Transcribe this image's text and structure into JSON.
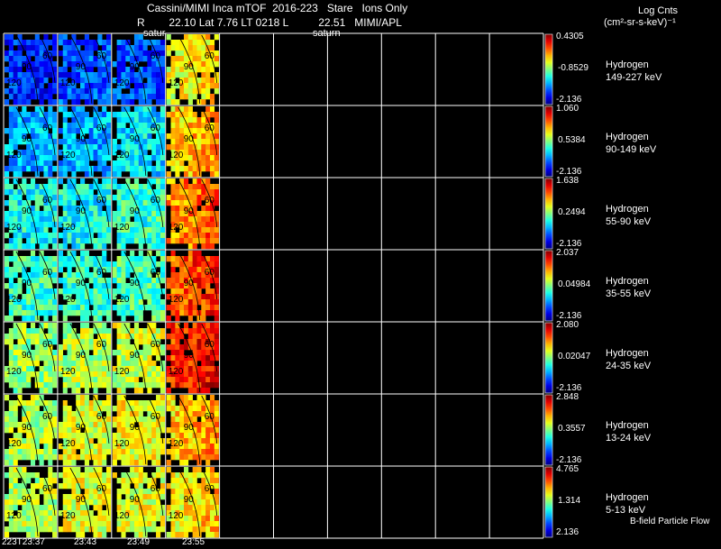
{
  "header": {
    "title": "Cassini/MIMI Inca mTOF  2016-223   Stare   Ions Only",
    "subtitle": "R        22.10 Lat 7.76 LT 0218 L          22.51   MIMI/APL",
    "units_line1": "Log Cnts",
    "units_line2": "(cm²-sr-s-keV)⁻¹",
    "saturn_left": "satur",
    "saturn_right": "saturn"
  },
  "footer": {
    "time_labels": [
      "223T23:37",
      "23:43",
      "23:49",
      "23:55"
    ],
    "flow_label": "B-field Particle Flow"
  },
  "colors": {
    "background": "#000000",
    "grid": "#ffffff"
  },
  "chart_data": {
    "type": "heatmap",
    "columns": 10,
    "populated_columns": 4,
    "contour_labels": [
      "90",
      "60",
      "120"
    ],
    "rows": [
      {
        "species": "Hydrogen",
        "energy": "149-227 keV",
        "max": "0.4305",
        "mid": "-0.8529",
        "min": "-2.136",
        "levels": [
          0.15,
          0.2,
          0.2,
          0.6
        ]
      },
      {
        "species": "Hydrogen",
        "energy": "90-149 keV",
        "max": "1.060",
        "mid": "0.5384",
        "min": "-2.136",
        "levels": [
          0.3,
          0.3,
          0.35,
          0.65
        ]
      },
      {
        "species": "Hydrogen",
        "energy": "55-90 keV",
        "max": "1.638",
        "mid": "0.2494",
        "min": "-2.136",
        "levels": [
          0.38,
          0.38,
          0.42,
          0.72
        ]
      },
      {
        "species": "Hydrogen",
        "energy": "35-55 keV",
        "max": "2.037",
        "mid": "0.04984",
        "min": "-2.136",
        "levels": [
          0.43,
          0.42,
          0.45,
          0.78
        ]
      },
      {
        "species": "Hydrogen",
        "energy": "24-35 keV",
        "max": "2.080",
        "mid": "0.02047",
        "min": "-2.136",
        "levels": [
          0.52,
          0.55,
          0.58,
          0.82
        ]
      },
      {
        "species": "Hydrogen",
        "energy": "13-24 keV",
        "max": "2.848",
        "mid": "0.3557",
        "min": "-2.136",
        "levels": [
          0.55,
          0.6,
          0.62,
          0.66
        ]
      },
      {
        "species": "Hydrogen",
        "energy": "5-13 keV",
        "max": "4.765",
        "mid": "1.314",
        "min": "2.136",
        "levels": [
          0.55,
          0.6,
          0.6,
          0.62
        ]
      }
    ]
  }
}
